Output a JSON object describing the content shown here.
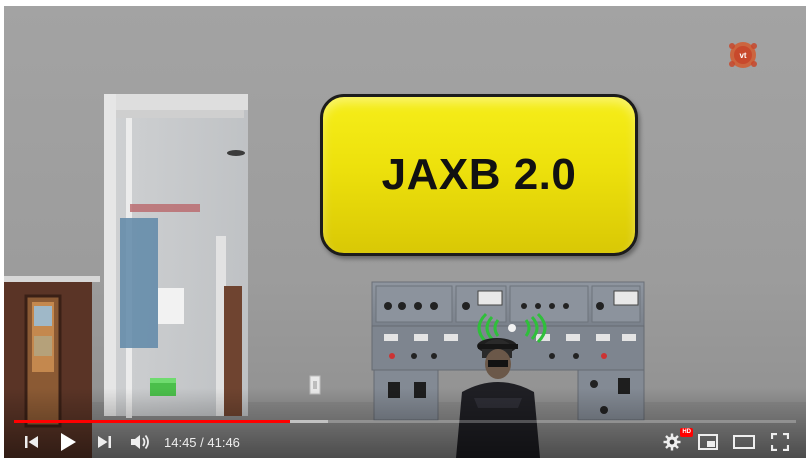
{
  "video": {
    "sign_text": "JAXB 2.0",
    "watermark_icon": "vt-logo-icon"
  },
  "player": {
    "played_fraction": 0.353,
    "buffered_fraction": 0.401,
    "time_display": "14:45 / 41:46",
    "hd_badge": "HD",
    "colors": {
      "progress_played": "#ff0000",
      "sign_yellow": "#efe20e"
    },
    "controls": {
      "previous_icon": "skip-previous-icon",
      "play_icon": "play-icon",
      "next_icon": "skip-next-icon",
      "volume_icon": "volume-icon",
      "settings_icon": "settings-gear-icon",
      "miniplayer_icon": "miniplayer-icon",
      "theater_icon": "theater-mode-icon",
      "fullscreen_icon": "fullscreen-icon"
    }
  }
}
